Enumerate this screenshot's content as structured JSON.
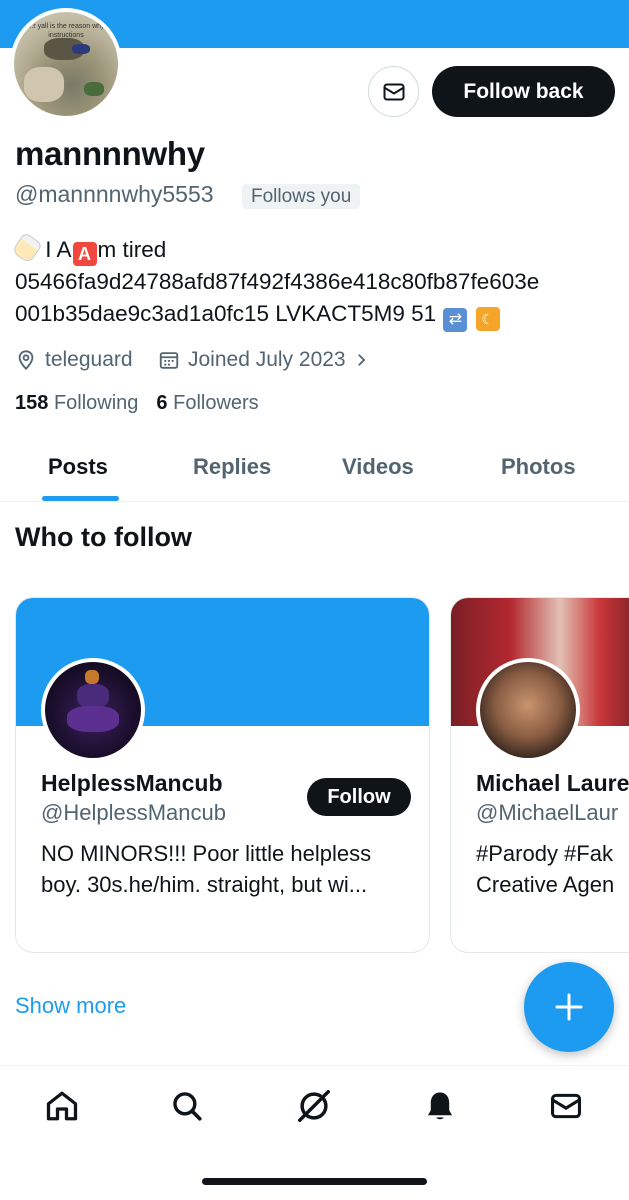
{
  "profile": {
    "display_name": "mannnnwhy",
    "handle": "@mannnnwhy5553",
    "follows_you_badge": "Follows you",
    "avatar_caption": "...r yall is the reason why instructions",
    "bio_part1": "I A",
    "bio_part2": "m tired",
    "bio_line2": "05466fa9d24788afd87f492f4386e418c80fb87fe603e",
    "bio_line3": "001b35dae9c3ad1a0fc15 LVKACT5M9 51",
    "emoji_a": "A",
    "location": "teleguard",
    "joined": "Joined July 2023",
    "following_count": "158",
    "following_label": "Following",
    "followers_count": "6",
    "followers_label": "Followers"
  },
  "actions": {
    "follow_back_label": "Follow back",
    "message_icon": "envelope-icon"
  },
  "tabs": [
    {
      "label": "Posts",
      "active": true
    },
    {
      "label": "Replies",
      "active": false
    },
    {
      "label": "Videos",
      "active": false
    },
    {
      "label": "Photos",
      "active": false
    }
  ],
  "who_to_follow": {
    "title": "Who to follow",
    "cards": [
      {
        "name": "HelplessMancub",
        "handle": "@HelplessMancub",
        "bio_line1": "NO MINORS!!! Poor little helpless",
        "bio_line2": "boy. 30s.he/him. straight, but wi...",
        "follow_label": "Follow",
        "banner_color": "#1d9bf0"
      },
      {
        "name": "Michael Laure",
        "handle": "@MichaelLaur",
        "bio_line1": "#Parody #Fak",
        "bio_line2": "Creative Agen"
      }
    ],
    "show_more": "Show more"
  },
  "bottom_nav": [
    {
      "icon": "home-icon"
    },
    {
      "icon": "search-icon"
    },
    {
      "icon": "grok-icon"
    },
    {
      "icon": "bell-icon"
    },
    {
      "icon": "envelope-icon"
    }
  ],
  "colors": {
    "accent": "#1d9bf0",
    "text_primary": "#0f1419",
    "text_secondary": "#536471"
  }
}
